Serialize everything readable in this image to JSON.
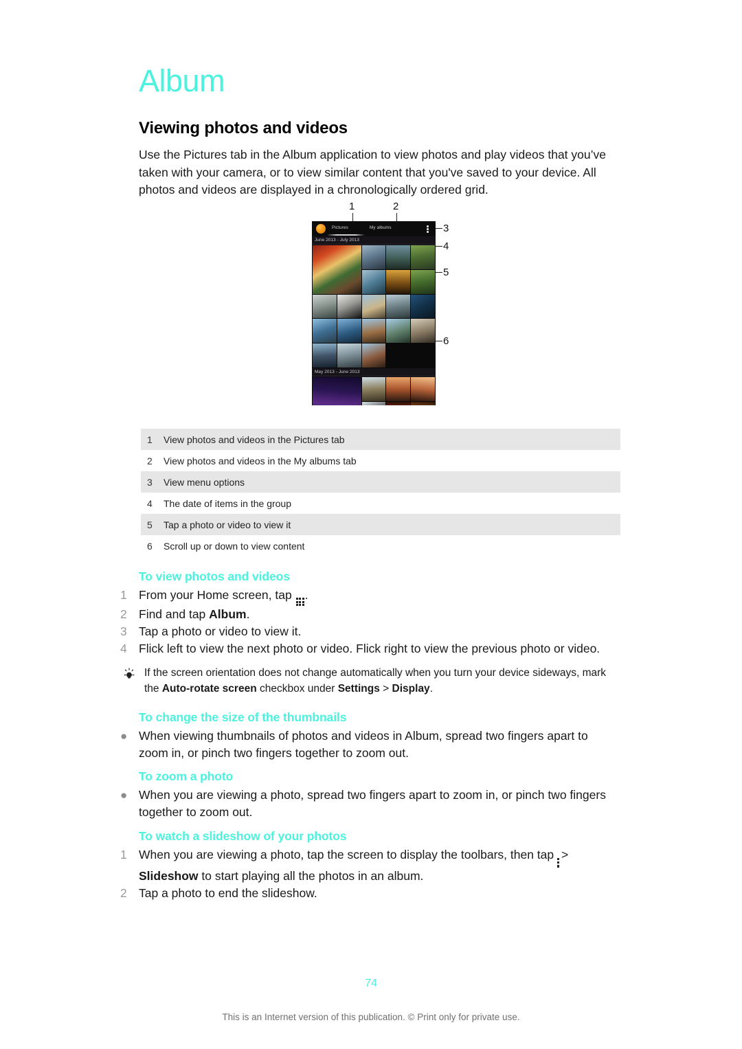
{
  "chapter": {
    "title": "Album"
  },
  "section": {
    "title": "Viewing photos and videos",
    "intro": "Use the Pictures tab in the Album application to view photos and play videos that you’ve taken with your camera, or to view similar content that you've saved to your device. All photos and videos are displayed in a chronologically ordered grid."
  },
  "figure": {
    "phone": {
      "tabs": [
        {
          "label": "Pictures",
          "active": true
        },
        {
          "label": "My albums",
          "active": false
        }
      ],
      "groups": [
        {
          "date_header": "June 2013 - July 2013"
        },
        {
          "date_header": "May 2013 - June 2013"
        }
      ],
      "menu_icon": "overflow-menu-icon",
      "app_icon": "album-app-icon"
    },
    "callouts": [
      "1",
      "2",
      "3",
      "4",
      "5",
      "6"
    ]
  },
  "legend": {
    "rows": [
      {
        "num": "1",
        "text": "View photos and videos in the Pictures tab"
      },
      {
        "num": "2",
        "text": "View photos and videos in the My albums tab"
      },
      {
        "num": "3",
        "text": "View menu options"
      },
      {
        "num": "4",
        "text": "The date of items in the group"
      },
      {
        "num": "5",
        "text": "Tap a photo or video to view it"
      },
      {
        "num": "6",
        "text": "Scroll up or down to view content"
      }
    ]
  },
  "procedures": {
    "view": {
      "title": "To view photos and videos",
      "steps": [
        {
          "num": "1",
          "pre": "From your Home screen, tap ",
          "icon": "app-drawer-icon",
          "post": "."
        },
        {
          "num": "2",
          "pre": "Find and tap ",
          "bold": "Album",
          "post": "."
        },
        {
          "num": "3",
          "pre": "Tap a photo or video to view it."
        },
        {
          "num": "4",
          "pre": "Flick left to view the next photo or video. Flick right to view the previous photo or video."
        }
      ]
    },
    "tip": {
      "icon": "lightbulb-icon",
      "pre": "If the screen orientation does not change automatically when you turn your device sideways, mark the ",
      "bold1": "Auto-rotate screen",
      "mid": " checkbox under ",
      "bold2": "Settings",
      "sep": " > ",
      "bold3": "Display",
      "post": "."
    },
    "thumbnails": {
      "title": "To change the size of the thumbnails",
      "bullet": "When viewing thumbnails of photos and videos in Album, spread two fingers apart to zoom in, or pinch two fingers together to zoom out."
    },
    "zoom": {
      "title": "To zoom a photo",
      "bullet": "When you are viewing a photo, spread two fingers apart to zoom in, or pinch two fingers together to zoom out."
    },
    "slideshow": {
      "title": "To watch a slideshow of your photos",
      "steps": [
        {
          "num": "1",
          "pre": "When you are viewing a photo, tap the screen to display the toolbars, then tap ",
          "icon": "overflow-menu-icon",
          "sep": "> ",
          "bold": "Slideshow",
          "post": " to start playing all the photos in an album."
        },
        {
          "num": "2",
          "pre": "Tap a photo to end the slideshow."
        }
      ]
    }
  },
  "footer": {
    "page_number": "74",
    "note": "This is an Internet version of this publication. © Print only for private use."
  },
  "colors": {
    "accent": "#4df2de",
    "table_shade": "#e6e6e6",
    "text": "#1a1a1a",
    "list_number": "#9a9a9a"
  }
}
